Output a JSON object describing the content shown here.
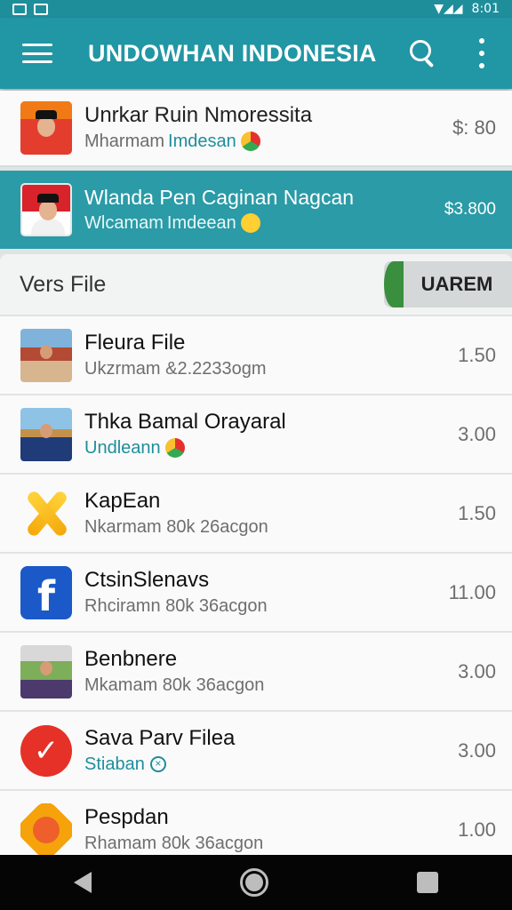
{
  "status_bar": {
    "time": "8:01"
  },
  "app_bar": {
    "title": "UNDOWHAN INDONESIA"
  },
  "featured": [
    {
      "name": "Unrkar Ruin Nmoressita",
      "sub": "Mharmam",
      "tag": "Imdesan",
      "price": "$: 80"
    },
    {
      "name": "Wlanda Pen Caginan Nagcan",
      "sub": "Wlcamam",
      "tag": "Imdeean",
      "price": "$3.800"
    }
  ],
  "section": {
    "title": "Vers File",
    "button_label": "UAREM"
  },
  "rows": [
    {
      "name": "Fleura File",
      "sub": "Ukzrmam  &2.2233ogm",
      "price": "1.50",
      "icon": "photo-house"
    },
    {
      "name": "Thka Bamal Orayaral",
      "sub": "Undleann",
      "price": "3.00",
      "icon": "photo-person"
    },
    {
      "name": "KapEan",
      "sub": "Nkarmam 80k 26acgon",
      "price": "1.50",
      "icon": "star-x-icon"
    },
    {
      "name": "CtsinSlenavs",
      "sub": "Rhciramn 80k 36acgon",
      "price": "11.00",
      "icon": "facebook-icon"
    },
    {
      "name": "Benbnere",
      "sub": "Mkamam 80k 36acgon",
      "price": "3.00",
      "icon": "photo-person-outdoor"
    },
    {
      "name": "Sava Parv Filea",
      "sub": "Stiaban",
      "price": "3.00",
      "icon": "check-circle-icon"
    },
    {
      "name": "Pespdan",
      "sub": "Rhamam 80k 36acgon",
      "price": "1.00",
      "icon": "badge-icon"
    }
  ],
  "colors": {
    "primary": "#2196a4",
    "highlight_row": "#2a9ba7",
    "accent_green": "#3a8f3e"
  }
}
